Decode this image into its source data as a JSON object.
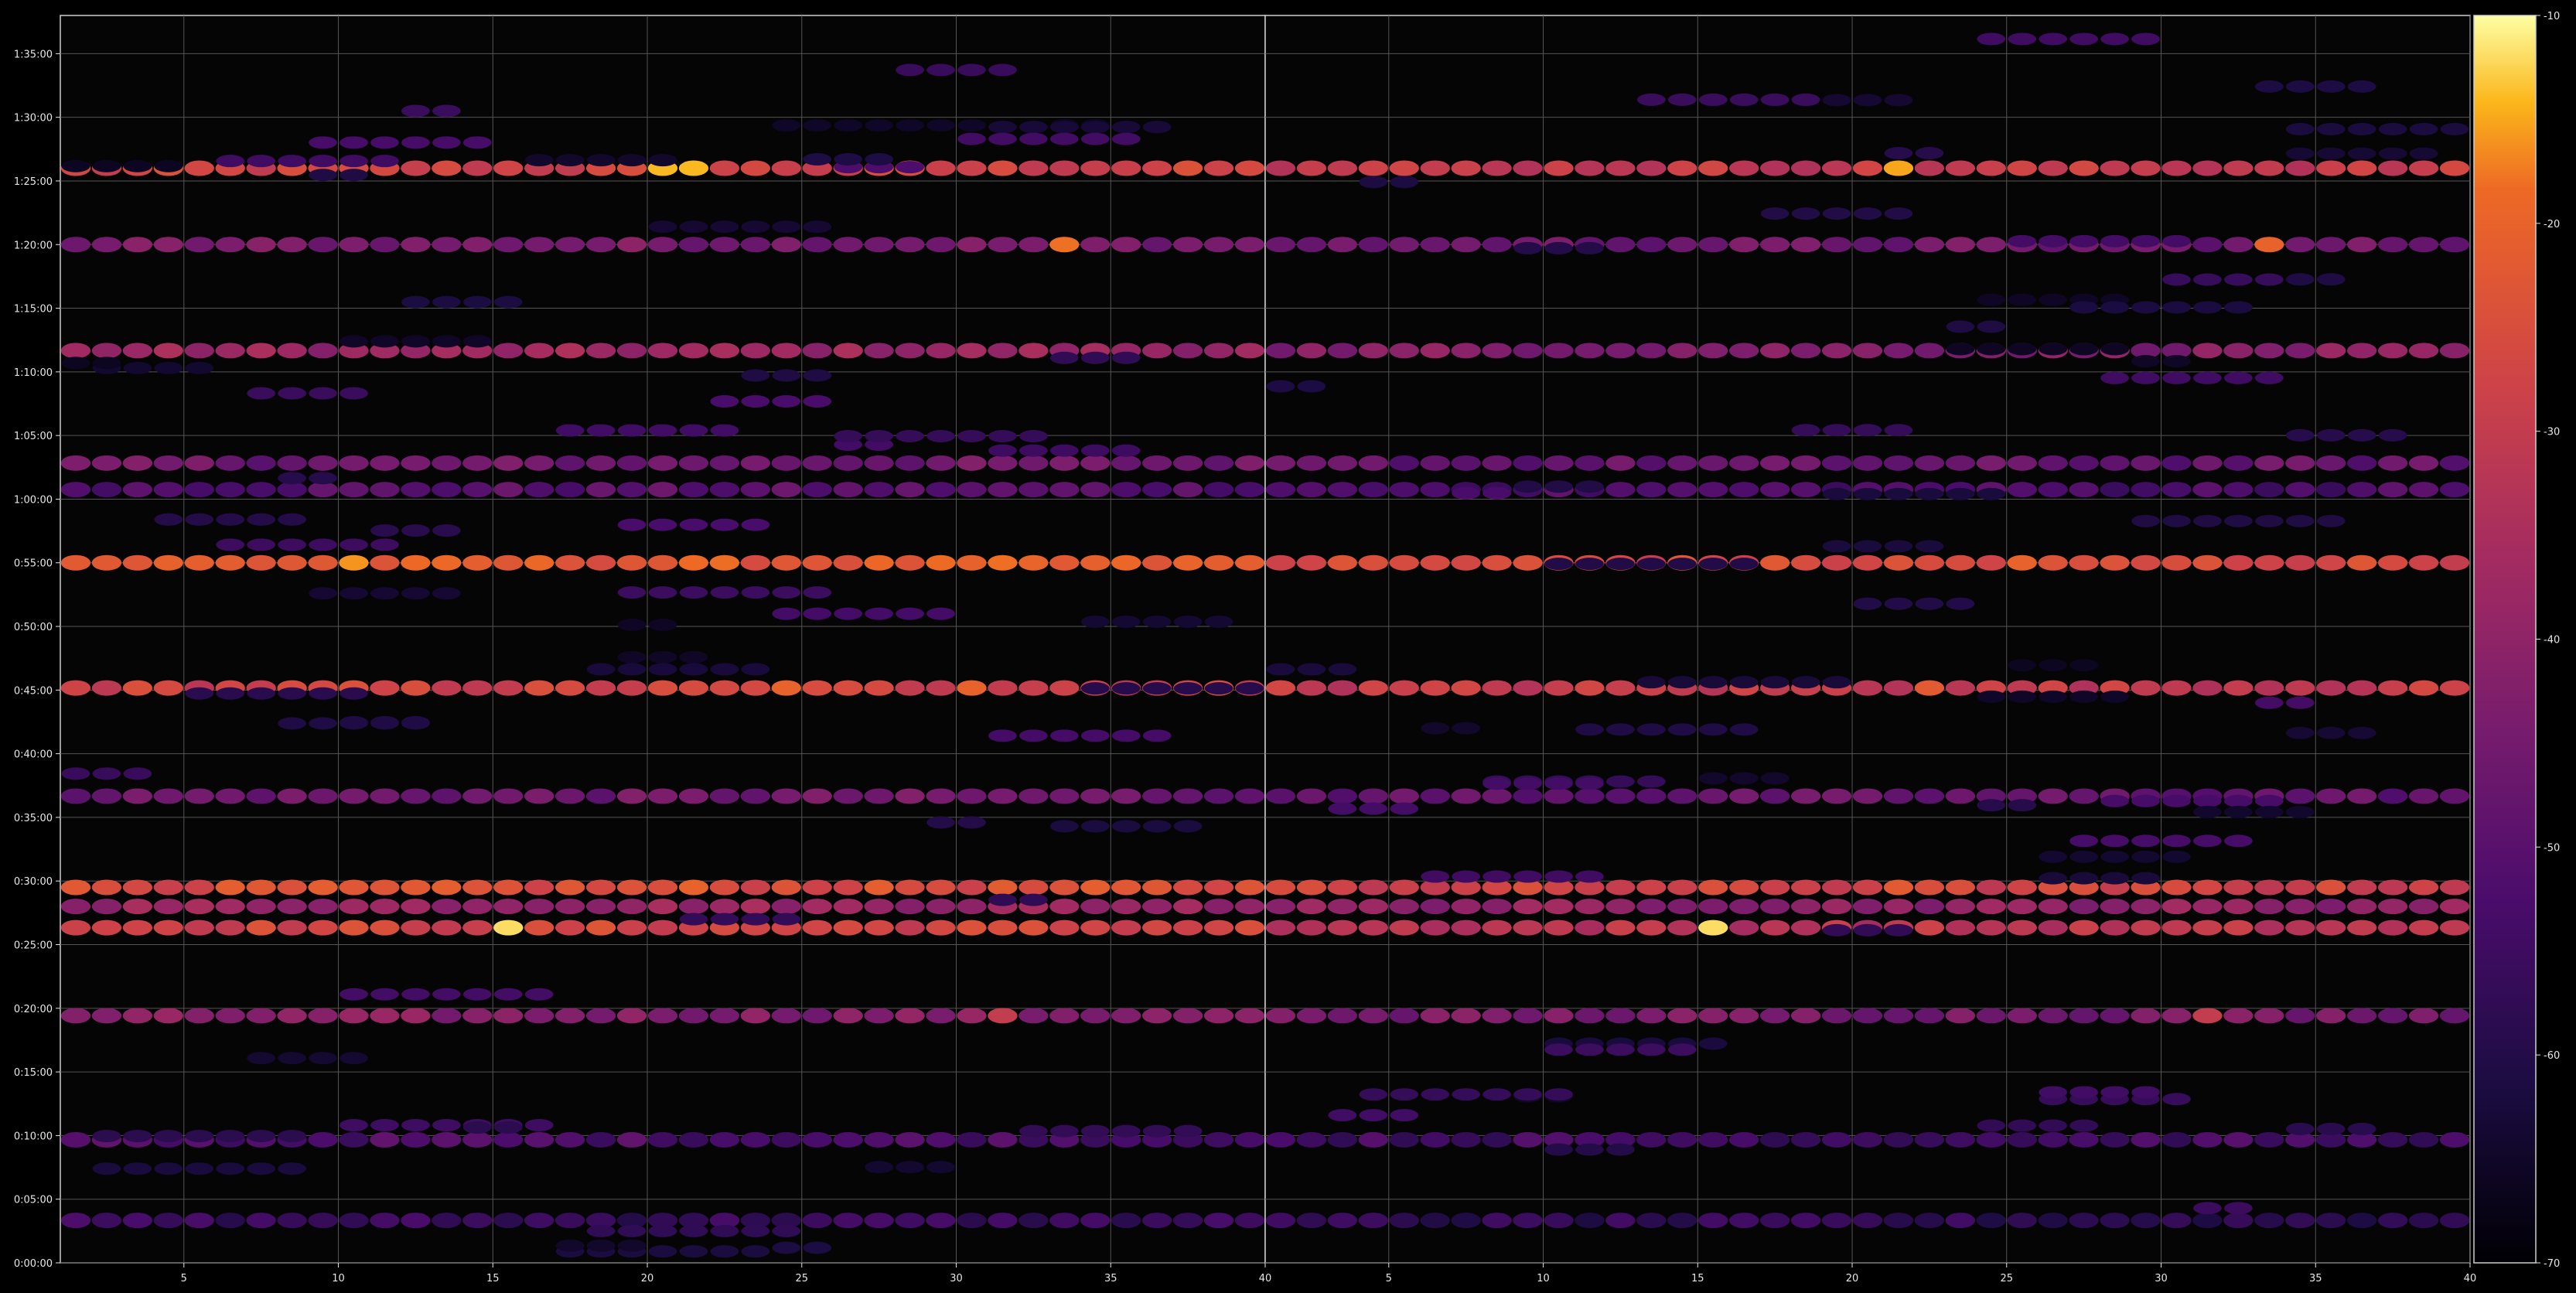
{
  "chart_data": {
    "type": "heatmap",
    "description_panels": 2,
    "colormap": "inferno",
    "grid": true,
    "x_ticks_left": [
      "5",
      "10",
      "15",
      "20",
      "25",
      "30",
      "35",
      "40"
    ],
    "x_tick_values_left": [
      5,
      10,
      15,
      20,
      25,
      30,
      35,
      40
    ],
    "x_ticks_right": [
      "5",
      "10",
      "15",
      "20",
      "25",
      "30",
      "35",
      "40"
    ],
    "x_tick_values_right": [
      5,
      10,
      15,
      20,
      25,
      30,
      35,
      40
    ],
    "xlim": [
      1,
      40
    ],
    "y_ticks": [
      "0:00:00",
      "0:05:00",
      "0:10:00",
      "0:15:00",
      "0:20:00",
      "0:25:00",
      "0:30:00",
      "0:35:00",
      "0:40:00",
      "0:45:00",
      "0:50:00",
      "0:55:00",
      "1:00:00",
      "1:05:00",
      "1:10:00",
      "1:15:00",
      "1:20:00",
      "1:25:00",
      "1:30:00",
      "1:35:00"
    ],
    "ylim_seconds": [
      0,
      5880
    ],
    "colorbar": {
      "ticks": [
        "-10",
        "-20",
        "-30",
        "-40",
        "-50",
        "-60",
        "-70"
      ],
      "tick_values": [
        -10,
        -20,
        -30,
        -40,
        -50,
        -60,
        -70
      ],
      "range": [
        -70,
        -10
      ]
    },
    "panels": [
      {
        "name": "",
        "rows": [
          {
            "t": 5160,
            "level": -28,
            "peak_x": [
              20,
              21
            ],
            "peak_level": -14
          },
          {
            "t": 4800,
            "level": -44,
            "peak_x": [
              33
            ],
            "peak_level": -18
          },
          {
            "t": 4300,
            "level": -38,
            "peak_x": [],
            "peak_level": -28
          },
          {
            "t": 3770,
            "level": -46,
            "peak_x": [],
            "peak_level": -40
          },
          {
            "t": 3645,
            "level": -50,
            "peak_x": [],
            "peak_level": -42
          },
          {
            "t": 3300,
            "level": -22,
            "peak_x": [
              10
            ],
            "peak_level": -16
          },
          {
            "t": 2710,
            "level": -28,
            "peak_x": [
              24,
              30
            ],
            "peak_level": -20
          },
          {
            "t": 2200,
            "level": -46,
            "peak_x": [],
            "peak_level": -40
          },
          {
            "t": 1770,
            "level": -25,
            "peak_x": [
              21
            ],
            "peak_level": -20
          },
          {
            "t": 1680,
            "level": -38,
            "peak_x": [],
            "peak_level": -28
          },
          {
            "t": 1580,
            "level": -27,
            "peak_x": [
              15
            ],
            "peak_level": -12
          },
          {
            "t": 1165,
            "level": -42,
            "peak_x": [
              31
            ],
            "peak_level": -30
          },
          {
            "t": 580,
            "level": -52,
            "peak_x": [],
            "peak_level": -40
          },
          {
            "t": 200,
            "level": -56,
            "peak_x": [],
            "peak_level": -46
          }
        ]
      },
      {
        "name": "",
        "rows": [
          {
            "t": 5160,
            "level": -30,
            "peak_x": [
              21
            ],
            "peak_level": -15
          },
          {
            "t": 4800,
            "level": -46,
            "peak_x": [
              33
            ],
            "peak_level": -20
          },
          {
            "t": 4300,
            "level": -42,
            "peak_x": [],
            "peak_level": -32
          },
          {
            "t": 3770,
            "level": -48,
            "peak_x": [],
            "peak_level": -42
          },
          {
            "t": 3645,
            "level": -52,
            "peak_x": [],
            "peak_level": -44
          },
          {
            "t": 3300,
            "level": -26,
            "peak_x": [
              25
            ],
            "peak_level": -20
          },
          {
            "t": 2710,
            "level": -30,
            "peak_x": [
              22
            ],
            "peak_level": -22
          },
          {
            "t": 2200,
            "level": -48,
            "peak_x": [],
            "peak_level": -42
          },
          {
            "t": 1770,
            "level": -28,
            "peak_x": [
              21
            ],
            "peak_level": -22
          },
          {
            "t": 1680,
            "level": -40,
            "peak_x": [],
            "peak_level": -30
          },
          {
            "t": 1580,
            "level": -32,
            "peak_x": [
              15
            ],
            "peak_level": -12
          },
          {
            "t": 1165,
            "level": -44,
            "peak_x": [
              31
            ],
            "peak_level": -30
          },
          {
            "t": 580,
            "level": -54,
            "peak_x": [],
            "peak_level": -42
          },
          {
            "t": 200,
            "level": -58,
            "peak_x": [],
            "peak_level": -48
          }
        ]
      }
    ]
  }
}
